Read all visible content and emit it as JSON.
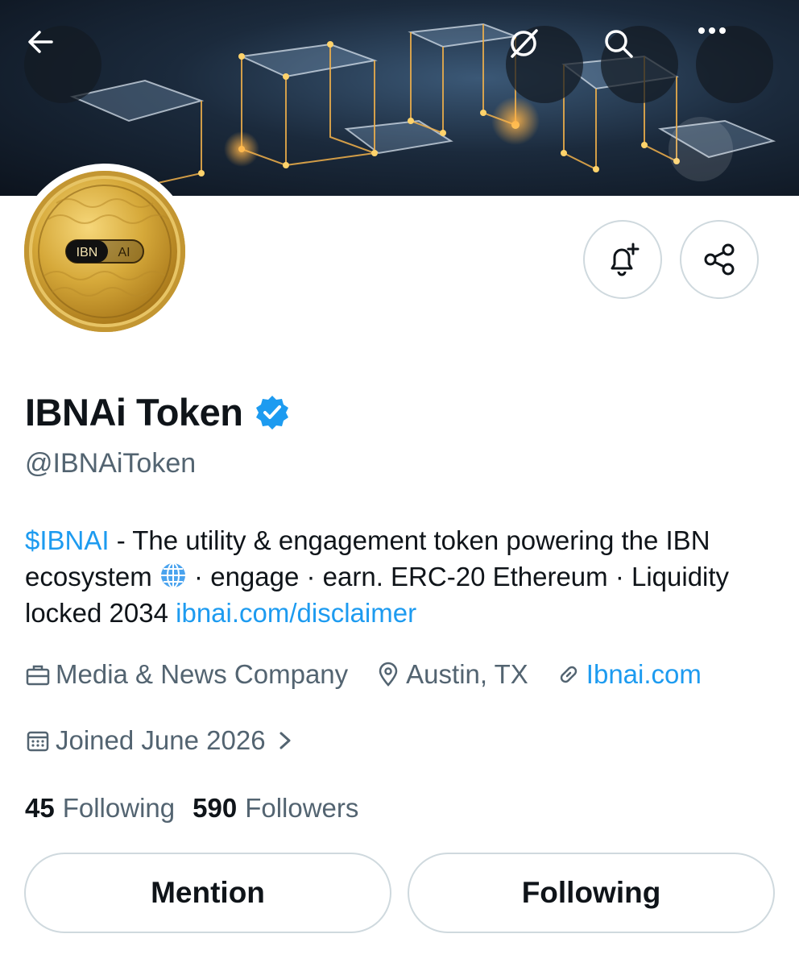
{
  "header": {
    "back_icon": "arrow-left-icon",
    "grok_icon": "grok-slash-icon",
    "search_icon": "search-icon",
    "more_icon": "more-dots-icon"
  },
  "avatar": {
    "coin_text_left": "IBN",
    "coin_text_right": "AI"
  },
  "actions": {
    "notify_icon": "bell-plus-icon",
    "share_icon": "share-icon"
  },
  "profile": {
    "display_name": "IBNAi Token",
    "verified_icon": "verified-badge-icon",
    "handle": "@IBNAiToken"
  },
  "bio": {
    "cashtag": "$IBNAI",
    "text_part1": " - The utility & engagement token powering the IBN ecosystem ",
    "globe_icon": "globe-icon",
    "text_part2": " · engage · earn. ERC-20 Ethereum · Liquidity locked 2034 ",
    "link": "ibnai.com/disclaimer"
  },
  "meta": {
    "category": "Media & News Company",
    "location": "Austin, TX",
    "website": "Ibnai.com",
    "joined": "Joined June 2026"
  },
  "stats": {
    "following_count": "45",
    "following_label": "Following",
    "followers_count": "590",
    "followers_label": "Followers"
  },
  "buttons": {
    "mention": "Mention",
    "following": "Following"
  },
  "colors": {
    "accent": "#1d9bf0",
    "secondary_text": "#536471",
    "border": "#cfd9de"
  }
}
